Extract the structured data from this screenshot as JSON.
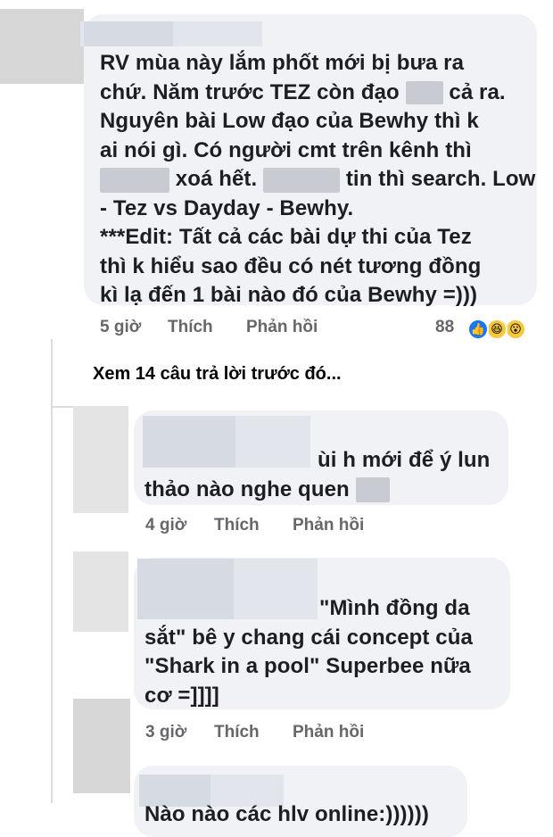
{
  "comments": [
    {
      "id": "main",
      "text_lines": [
        "RV mùa này lắm phốt mới bị bưa ra",
        "chứ. Năm trước TEZ còn đạo",
        "cả ra.",
        "Nguyên bài Low đạo của Bewhy thì k",
        "ai nói gì. Có người cmt trên kênh thì",
        "xoá hết.",
        "tin thì search. Low",
        "- Tez vs Dayday - Bewhy.",
        "***Edit: Tất cả các bài dự thi của Tez",
        "thì k hiểu sao đều có nét tương đồng",
        "kì lạ đến 1 bài nào đó của Bewhy =)))"
      ],
      "time": "5 giờ",
      "like": "Thích",
      "reply": "Phản hồi",
      "reaction_count": "88",
      "reactions": [
        "like-reaction",
        "haha-reaction",
        "wow-reaction"
      ]
    },
    {
      "id": "reply1",
      "text_lines": [
        "ùi h mới để ý lun",
        "thảo nào nghe quen"
      ],
      "time": "4 giờ",
      "like": "Thích",
      "reply": "Phản hồi"
    },
    {
      "id": "reply2",
      "text_lines": [
        "\"Mình đồng da",
        "sắt\" bê y chang cái concept của",
        "\"Shark in a pool\" Superbee nữa",
        "cơ =]]]]"
      ],
      "time": "3 giờ",
      "like": "Thích",
      "reply": "Phản hồi"
    },
    {
      "id": "reply3",
      "text_lines": [
        "Nào nào các hlv online:))))))"
      ]
    }
  ],
  "view_previous": "Xem 14 câu trả lời trước đó...",
  "colors": {
    "bubble": "#f0f2f5",
    "meta": "#65676b",
    "text": "#1c1e21",
    "like_blue": "#1877f2",
    "emoji_yellow": "#f7c83b"
  }
}
